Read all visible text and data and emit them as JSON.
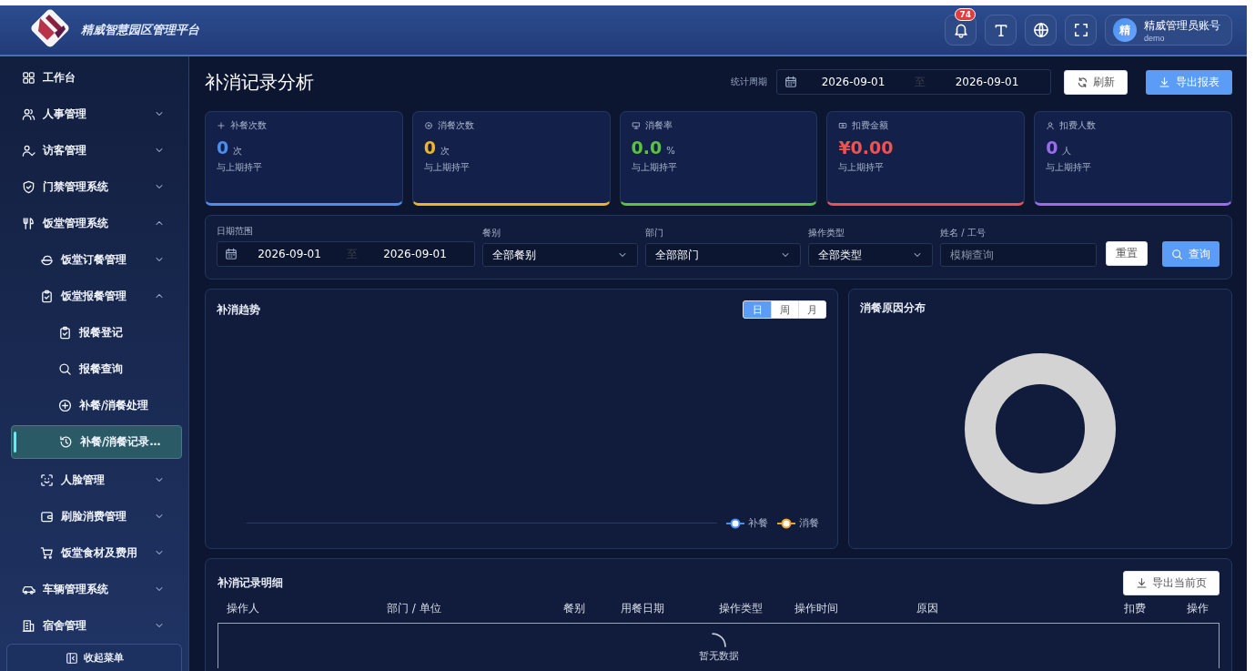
{
  "header": {
    "title": "精威智慧园区管理平台",
    "notification_count": "74",
    "user": {
      "avatar": "精",
      "name": "精威管理员账号",
      "account": "demo"
    }
  },
  "sidebar": {
    "items": [
      {
        "label": "工作台",
        "selected": false
      },
      {
        "label": "人事管理",
        "expanded": false,
        "selected": false
      },
      {
        "label": "访客管理",
        "expanded": false,
        "selected": false
      },
      {
        "label": "门禁管理系统",
        "expanded": false,
        "selected": false
      },
      {
        "label": "饭堂管理系统",
        "expanded": true,
        "selected": false,
        "children": [
          {
            "label": "饭堂订餐管理",
            "expanded": false,
            "selected": false
          },
          {
            "label": "饭堂报餐管理",
            "expanded": true,
            "selected": false,
            "children": [
              {
                "label": "报餐登记",
                "selected": false
              },
              {
                "label": "报餐查询",
                "selected": false
              },
              {
                "label": "补餐/消餐处理",
                "selected": false
              },
              {
                "label": "补餐/消餐记录…",
                "selected": true
              }
            ]
          },
          {
            "label": "人脸管理",
            "expanded": false,
            "selected": false
          },
          {
            "label": "刷脸消费管理",
            "expanded": false,
            "selected": false
          },
          {
            "label": "饭堂食材及费用",
            "expanded": false,
            "selected": false
          }
        ]
      },
      {
        "label": "车辆管理系统",
        "expanded": false,
        "selected": false
      },
      {
        "label": "宿舍管理",
        "expanded": false,
        "selected": false
      }
    ],
    "collapse_button": "收起菜单"
  },
  "page": {
    "title": "补消记录分析",
    "period_label": "统计周期",
    "period_start": "2026-09-01",
    "period_separator": "至",
    "period_end": "2026-09-01",
    "refresh_button": "刷新",
    "export_button": "导出报表"
  },
  "stats": [
    {
      "label": "补餐次数",
      "value": "0",
      "unit": "次",
      "note": "与上期持平",
      "color": "#4a8ff0"
    },
    {
      "label": "消餐次数",
      "value": "0",
      "unit": "次",
      "note": "与上期持平",
      "color": "#f0b42c"
    },
    {
      "label": "消餐率",
      "value": "0.0",
      "unit": "%",
      "note": "与上期持平",
      "color": "#5cc43a"
    },
    {
      "label": "扣费金额",
      "value": "¥0.00",
      "note": "与上期持平",
      "color": "#f0524f"
    },
    {
      "label": "扣费人数",
      "value": "0",
      "unit": "人",
      "note": "与上期持平",
      "color": "#9c6cf0"
    }
  ],
  "filters": {
    "date_label": "日期范围",
    "date_start": "2026-09-01",
    "date_separator": "至",
    "date_end": "2026-09-01",
    "selects": [
      {
        "label": "餐别",
        "value": "全部餐别"
      },
      {
        "label": "部门",
        "value": "全部部门"
      },
      {
        "label": "操作类型",
        "value": "全部类型"
      }
    ],
    "name_label": "姓名 / 工号",
    "name_placeholder": "模糊查询",
    "reset_button": "重置",
    "query_button": "查询"
  },
  "trend": {
    "title": "补消趋势",
    "periods": [
      {
        "label": "日",
        "selected": true
      },
      {
        "label": "周",
        "selected": false
      },
      {
        "label": "月",
        "selected": false
      }
    ],
    "legend": [
      {
        "label": "补餐",
        "color": "#4a8ff0"
      },
      {
        "label": "消餐",
        "color": "#f0a02c"
      }
    ]
  },
  "reasons": {
    "title": "消餐原因分布"
  },
  "table": {
    "title": "补消记录明细",
    "export_button": "导出当前页",
    "columns": [
      "操作人",
      "部门 / 单位",
      "餐别",
      "用餐日期",
      "操作类型",
      "操作时间",
      "原因",
      "扣费",
      "操作"
    ],
    "empty_text": "暂无数据"
  }
}
